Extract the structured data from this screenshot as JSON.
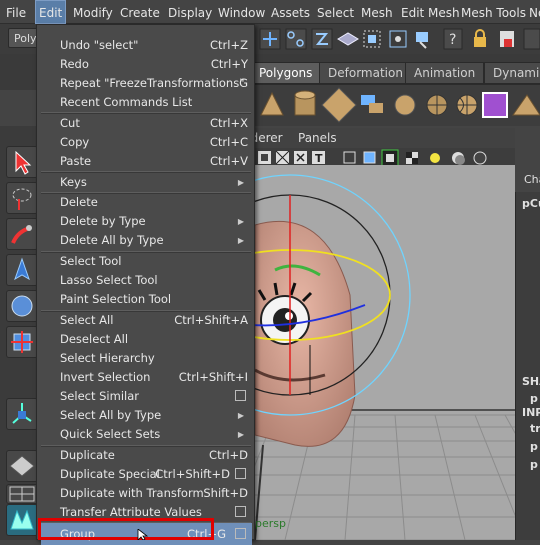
{
  "menubar": {
    "items": [
      "File",
      "Edit",
      "Modify",
      "Create",
      "Display",
      "Window",
      "Assets",
      "Select",
      "Mesh",
      "Edit Mesh",
      "Mesh Tools",
      "No"
    ]
  },
  "toolbar": {
    "mode_label": "Poly"
  },
  "shelf_tabs": [
    "Polygons",
    "Deformation",
    "Animation",
    "Dynamics"
  ],
  "viewport": {
    "menu_items": [
      "nderer",
      "Panels"
    ],
    "camera_label": "persp"
  },
  "right_panel": {
    "tab_label": "Cha",
    "node_name": "pCu",
    "rows": [
      "SHA",
      "p",
      "INP",
      "tr",
      "p",
      "p"
    ]
  },
  "edit_menu": {
    "items": [
      {
        "label": "Undo \"select\"",
        "shortcut": "Ctrl+Z"
      },
      {
        "label": "Redo",
        "shortcut": "Ctrl+Y"
      },
      {
        "label": "Repeat \"FreezeTransformations\"",
        "shortcut": "G"
      },
      {
        "label": "Recent Commands List",
        "shortcut": ""
      },
      {
        "label": "Cut",
        "shortcut": "Ctrl+X"
      },
      {
        "label": "Copy",
        "shortcut": "Ctrl+C"
      },
      {
        "label": "Paste",
        "shortcut": "Ctrl+V"
      },
      {
        "label": "Keys",
        "shortcut": ""
      },
      {
        "label": "Delete",
        "shortcut": ""
      },
      {
        "label": "Delete by Type",
        "shortcut": ""
      },
      {
        "label": "Delete All by Type",
        "shortcut": ""
      },
      {
        "label": "Select Tool",
        "shortcut": ""
      },
      {
        "label": "Lasso Select Tool",
        "shortcut": ""
      },
      {
        "label": "Paint Selection Tool",
        "shortcut": ""
      },
      {
        "label": "Select All",
        "shortcut": "Ctrl+Shift+A"
      },
      {
        "label": "Deselect All",
        "shortcut": ""
      },
      {
        "label": "Select Hierarchy",
        "shortcut": ""
      },
      {
        "label": "Invert Selection",
        "shortcut": "Ctrl+Shift+I"
      },
      {
        "label": "Select Similar",
        "shortcut": ""
      },
      {
        "label": "Select All by Type",
        "shortcut": ""
      },
      {
        "label": "Quick Select Sets",
        "shortcut": ""
      },
      {
        "label": "Duplicate",
        "shortcut": "Ctrl+D"
      },
      {
        "label": "Duplicate Special",
        "shortcut": "Ctrl+Shift+D"
      },
      {
        "label": "Duplicate with Transform",
        "shortcut": "Shift+D"
      },
      {
        "label": "Transfer Attribute Values",
        "shortcut": ""
      },
      {
        "label": "Group",
        "shortcut": "Ctrl+G"
      }
    ]
  },
  "colors": {
    "menu_highlight": "#6f8fb9",
    "callout_border": "#e00000",
    "viewport_bg": "#a8a8a8"
  },
  "icons": [
    "select-arrow-icon",
    "lasso-icon",
    "paint-select-icon",
    "move-icon",
    "rotate-icon",
    "scale-icon",
    "manipulator-icon",
    "sphere-icon",
    "cube-icon",
    "help-icon",
    "lock-icon"
  ]
}
